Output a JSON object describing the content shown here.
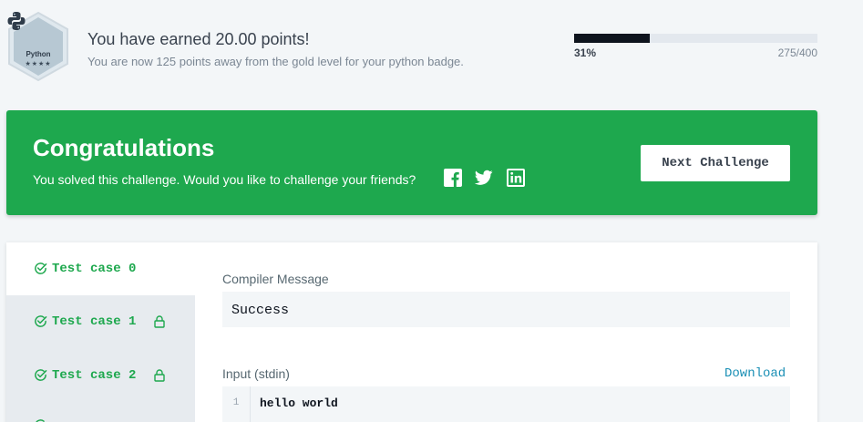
{
  "badge": {
    "name": "Python",
    "stars": "★★★★",
    "icon": "python-logo-icon"
  },
  "earned": {
    "title": "You have earned 20.00 points!",
    "subtitle": "You are now 125 points away from the gold level for your python badge."
  },
  "progress": {
    "percent_label": "31%",
    "count_label": "275/400",
    "fraction": 0.3125
  },
  "congrats": {
    "title": "Congratulations",
    "subtitle": "You solved this challenge. Would you like to challenge your friends?",
    "social_icons": [
      "facebook-icon",
      "twitter-icon",
      "linkedin-icon"
    ],
    "next_button": "Next Challenge",
    "color": "#1ea84e"
  },
  "test_cases": [
    {
      "label": "Test case 0",
      "locked": false,
      "active": true
    },
    {
      "label": "Test case 1",
      "locked": true,
      "active": false
    },
    {
      "label": "Test case 2",
      "locked": true,
      "active": false
    }
  ],
  "compiler": {
    "label": "Compiler Message",
    "message": "Success"
  },
  "input": {
    "label": "Input (stdin)",
    "download": "Download",
    "line_number": "1",
    "line_text": "hello world"
  }
}
